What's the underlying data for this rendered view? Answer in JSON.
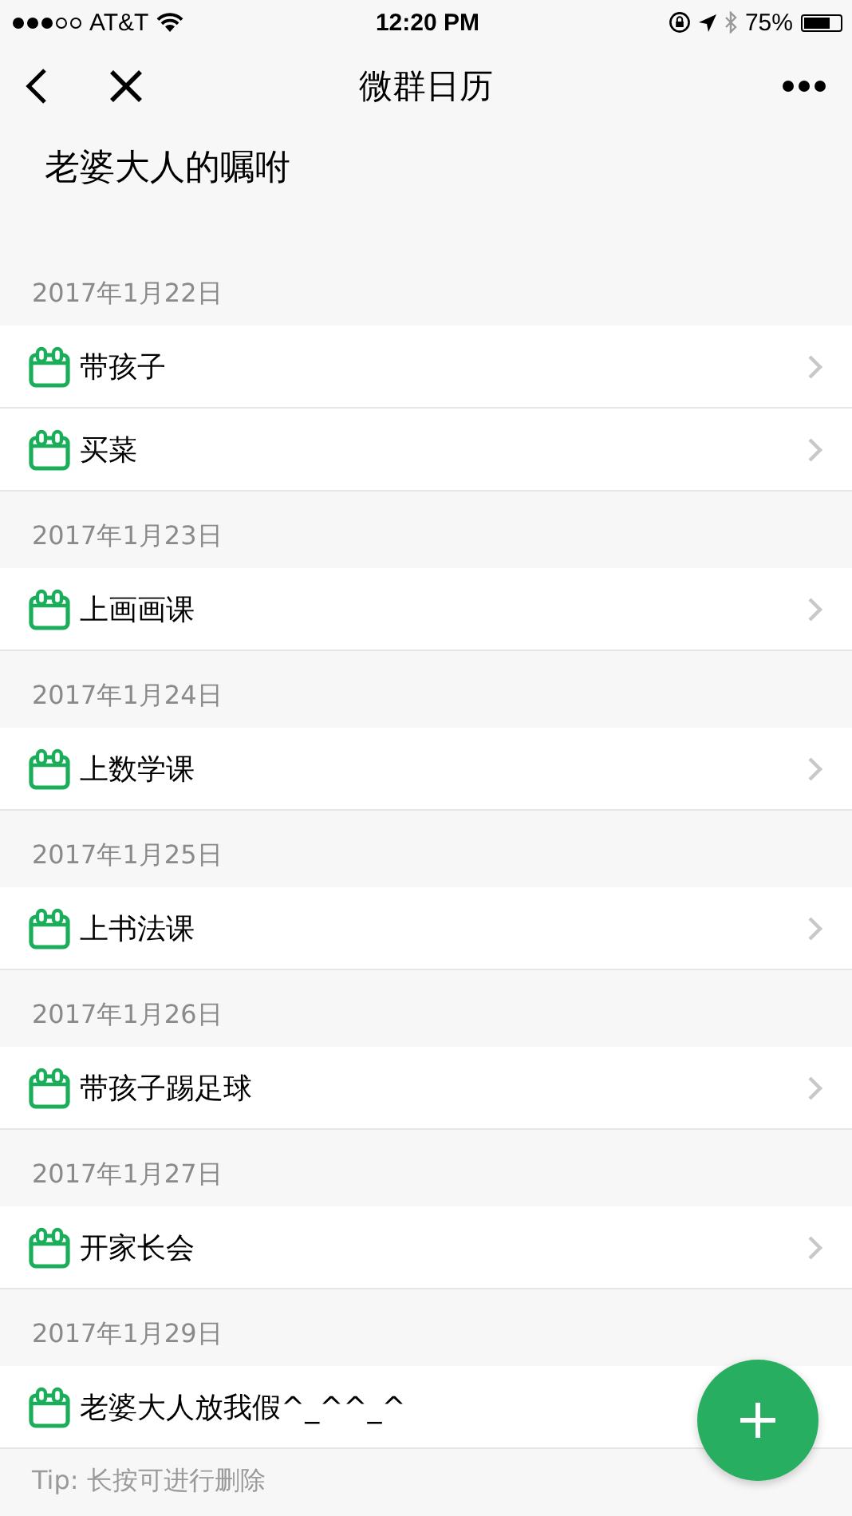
{
  "status_bar": {
    "carrier": "AT&T",
    "time": "12:20 PM",
    "battery": "75%"
  },
  "nav": {
    "title": "微群日历"
  },
  "page_title": "老婆大人的嘱咐",
  "groups": [
    {
      "date": "2017年1月22日",
      "items": [
        {
          "text": "带孩子",
          "arrow": true
        },
        {
          "text": "买菜",
          "arrow": true
        }
      ]
    },
    {
      "date": "2017年1月23日",
      "items": [
        {
          "text": "上画画课",
          "arrow": true
        }
      ]
    },
    {
      "date": "2017年1月24日",
      "items": [
        {
          "text": "上数学课",
          "arrow": true
        }
      ]
    },
    {
      "date": "2017年1月25日",
      "items": [
        {
          "text": "上书法课",
          "arrow": true
        }
      ]
    },
    {
      "date": "2017年1月26日",
      "items": [
        {
          "text": "带孩子踢足球",
          "arrow": true
        }
      ]
    },
    {
      "date": "2017年1月27日",
      "items": [
        {
          "text": "开家长会",
          "arrow": true
        }
      ]
    },
    {
      "date": "2017年1月29日",
      "items": [
        {
          "text": "老婆大人放我假^_^^_^",
          "arrow": false
        }
      ]
    }
  ],
  "tip": "Tip: 长按可进行删除"
}
